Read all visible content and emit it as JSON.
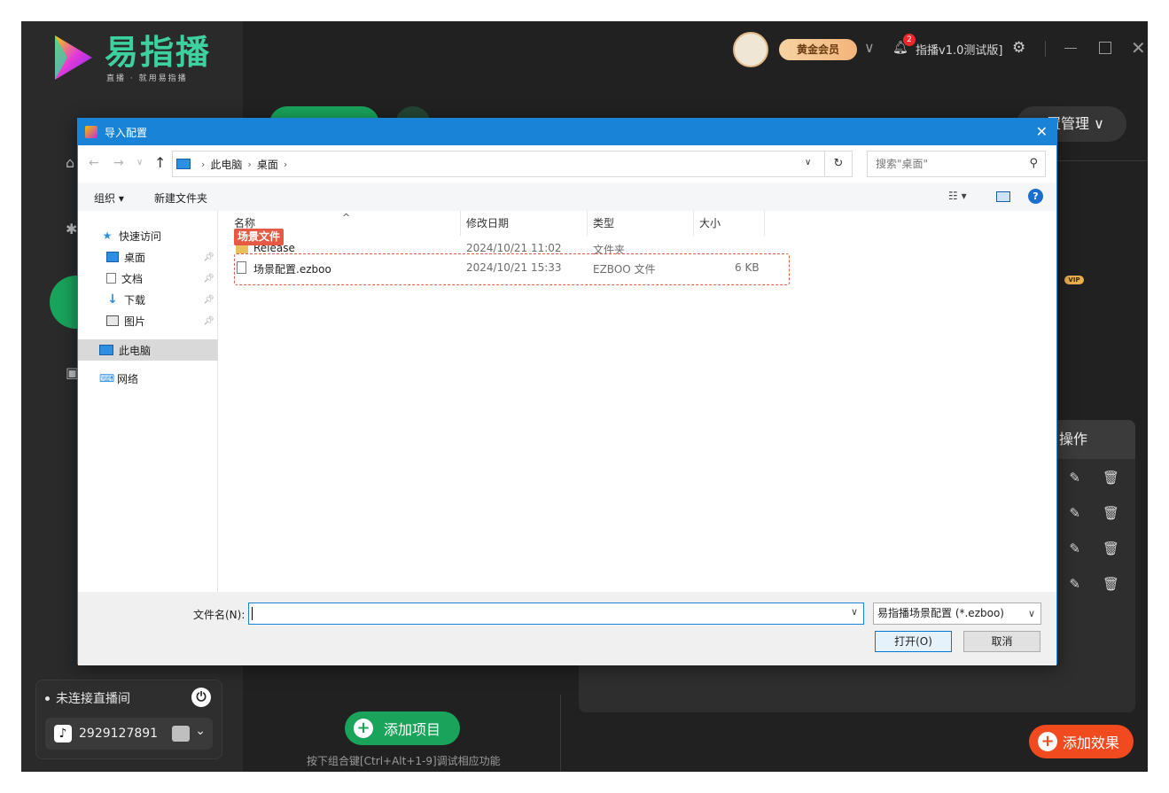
{
  "app": {
    "brand_name": "易指播",
    "brand_slogan": "直播 · 就用易指播",
    "vip_badge": "黄金会员",
    "notification_count": "2",
    "version": "指播v1.0测试版]",
    "management_label": "置管理 ∨",
    "ops_header": "操作",
    "vip_tag": "VIP",
    "connection_status": "未连接直播间",
    "account_id": "2929127891",
    "add_project_label": "添加项目",
    "hotkey_hint": "按下组合键[Ctrl+Alt+1-9]调试相应功能",
    "add_effect_label": "添加效果",
    "brand_color": "#19a35b",
    "effect_color": "#f04a1e"
  },
  "dialog": {
    "title": "导入配置",
    "breadcrumb": [
      "此电脑",
      "桌面"
    ],
    "search_placeholder": "搜索\"桌面\"",
    "toolbar": {
      "organize": "组织 ▾",
      "new_folder": "新建文件夹"
    },
    "nav_pane": [
      {
        "label": "快速访问",
        "icon": "star-icon"
      },
      {
        "label": "桌面",
        "icon": "desktop-icon",
        "pinned": true
      },
      {
        "label": "文档",
        "icon": "document-icon",
        "pinned": true
      },
      {
        "label": "下载",
        "icon": "download-icon",
        "pinned": true
      },
      {
        "label": "图片",
        "icon": "picture-icon",
        "pinned": true
      },
      {
        "label": "此电脑",
        "icon": "computer-icon",
        "selected": true
      },
      {
        "label": "网络",
        "icon": "network-icon"
      }
    ],
    "columns": [
      "名称",
      "修改日期",
      "类型",
      "大小"
    ],
    "files": [
      {
        "name": "Release",
        "date": "2024/10/21 11:02",
        "type": "文件夹",
        "size": ""
      },
      {
        "name": "场景配置.ezboo",
        "date": "2024/10/21 15:33",
        "type": "EZBOO 文件",
        "size": "6 KB"
      }
    ],
    "annotation_label": "场景文件",
    "filename_label": "文件名(N):",
    "filename_value": "",
    "filetype": "易指播场景配置 (*.ezboo)",
    "open_button": "打开(O)",
    "cancel_button": "取消"
  }
}
